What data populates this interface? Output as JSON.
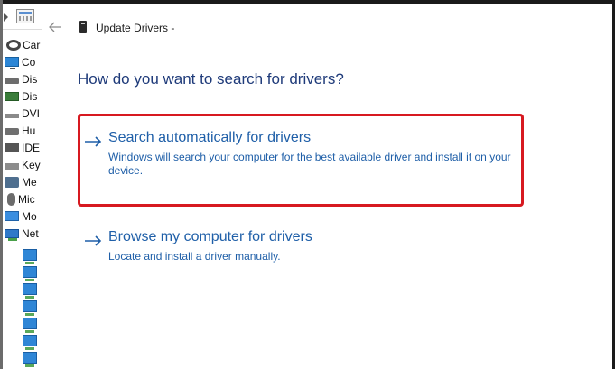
{
  "device_manager": {
    "items": [
      {
        "icon": "camera-icon",
        "label": "Car"
      },
      {
        "icon": "computer-icon",
        "label": "Co"
      },
      {
        "icon": "disk-drive-icon",
        "label": "Dis"
      },
      {
        "icon": "display-adapter-icon",
        "label": "Dis"
      },
      {
        "icon": "dvd-drive-icon",
        "label": "DVI"
      },
      {
        "icon": "hid-icon",
        "label": "Hu"
      },
      {
        "icon": "ide-controller-icon",
        "label": "IDE"
      },
      {
        "icon": "keyboard-icon",
        "label": "Key"
      },
      {
        "icon": "memory-icon",
        "label": "Me"
      },
      {
        "icon": "mouse-icon",
        "label": "Mic"
      },
      {
        "icon": "monitor-icon",
        "label": "Mo"
      },
      {
        "icon": "network-adapter-icon",
        "label": "Net"
      }
    ],
    "sub_item_icon": "network-adapter-icon",
    "sub_item_count": 7
  },
  "dialog": {
    "title": "Update Drivers -",
    "heading": "How do you want to search for drivers?",
    "options": [
      {
        "title": "Search automatically for drivers",
        "description": "Windows will search your computer for the best available driver and install it on your device.",
        "highlighted": true
      },
      {
        "title": "Browse my computer for drivers",
        "description": "Locate and install a driver manually.",
        "highlighted": false
      }
    ]
  },
  "colors": {
    "link_blue": "#1f5fa8",
    "heading_blue": "#1f3b7a",
    "highlight_red": "#d71920"
  }
}
